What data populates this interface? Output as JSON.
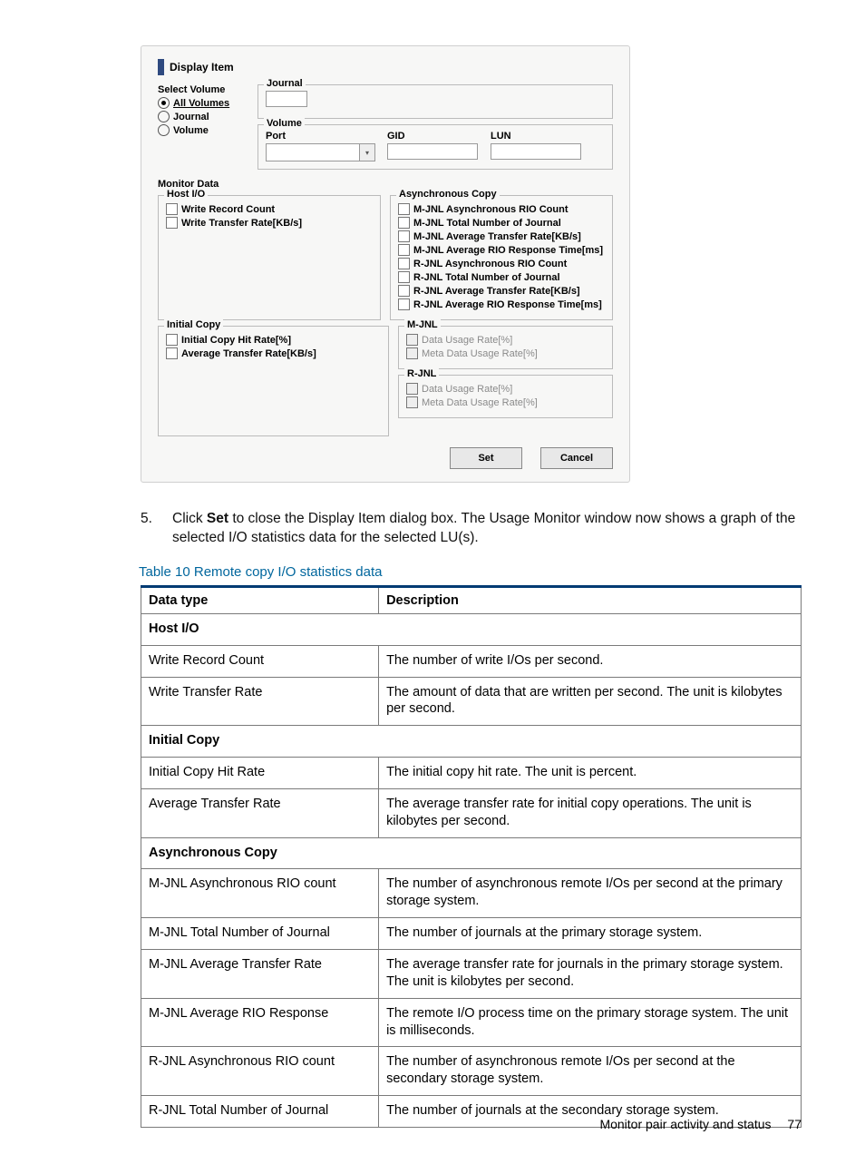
{
  "dialog": {
    "title": "Display Item",
    "select_volume": {
      "label": "Select Volume",
      "opt_all": "All Volumes",
      "opt_journal": "Journal",
      "opt_volume": "Volume"
    },
    "journal_box": {
      "legend": "Journal"
    },
    "volume_box": {
      "legend": "Volume",
      "port": "Port",
      "gid": "GID",
      "lun": "LUN"
    },
    "monitor_label": "Monitor Data",
    "host_io": {
      "legend": "Host I/O",
      "write_record": "Write Record Count",
      "write_rate": "Write Transfer Rate[KB/s]"
    },
    "async": {
      "legend": "Asynchronous Copy",
      "m_rio": "M-JNL Asynchronous RIO Count",
      "m_total": "M-JNL Total Number of Journal",
      "m_rate": "M-JNL Average Transfer Rate[KB/s]",
      "m_resp": "M-JNL Average RIO Response Time[ms]",
      "r_rio": "R-JNL Asynchronous RIO Count",
      "r_total": "R-JNL Total Number of Journal",
      "r_rate": "R-JNL Average Transfer Rate[KB/s]",
      "r_resp": "R-JNL Average RIO Response Time[ms]"
    },
    "initial_copy": {
      "legend": "Initial Copy",
      "hit": "Initial Copy Hit Rate[%]",
      "avg": "Average Transfer Rate[KB/s]"
    },
    "mjnl": {
      "legend": "M-JNL",
      "data": "Data Usage Rate[%]",
      "meta": "Meta Data Usage Rate[%]"
    },
    "rjnl": {
      "legend": "R-JNL",
      "data": "Data Usage Rate[%]",
      "meta": "Meta Data Usage Rate[%]"
    },
    "buttons": {
      "set": "Set",
      "cancel": "Cancel"
    }
  },
  "step": {
    "num": "5.",
    "pre": "Click ",
    "bold": "Set",
    "post": " to close the Display Item dialog box. The Usage Monitor window now shows a graph of the selected I/O statistics data for the selected LU(s)."
  },
  "table_caption": "Table 10 Remote copy I/O statistics data",
  "table": {
    "h1": "Data type",
    "h2": "Description",
    "rows": [
      {
        "section": true,
        "c1": "Host I/O",
        "c2": ""
      },
      {
        "c1": "Write Record Count",
        "c2": "The number of write I/Os per second."
      },
      {
        "c1": "Write Transfer Rate",
        "c2": "The amount of data that are written per second. The unit is kilobytes per second."
      },
      {
        "section": true,
        "c1": "Initial Copy",
        "c2": ""
      },
      {
        "c1": "Initial Copy Hit Rate",
        "c2": "The initial copy hit rate. The unit is percent."
      },
      {
        "c1": "Average Transfer Rate",
        "c2": "The average transfer rate for initial copy operations. The unit is kilobytes per second."
      },
      {
        "section": true,
        "c1": "Asynchronous Copy",
        "c2": ""
      },
      {
        "c1": "M-JNL Asynchronous RIO count",
        "c2": "The number of asynchronous remote I/Os per second at the primary storage system."
      },
      {
        "c1": "M-JNL Total Number of Journal",
        "c2": "The number of journals at the primary storage system."
      },
      {
        "c1": "M-JNL Average Transfer Rate",
        "c2": "The average transfer rate for journals in the primary storage system. The unit is kilobytes per second."
      },
      {
        "c1": "M-JNL Average RIO Response",
        "c2": "The remote I/O process time on the primary storage system. The unit is milliseconds."
      },
      {
        "c1": "R-JNL Asynchronous RIO count",
        "c2": "The number of asynchronous remote I/Os per second at the secondary storage system."
      },
      {
        "c1": "R-JNL Total Number of Journal",
        "c2": "The number of journals at the secondary storage system."
      }
    ]
  },
  "footer": {
    "text": "Monitor pair activity and status",
    "page": "77"
  }
}
